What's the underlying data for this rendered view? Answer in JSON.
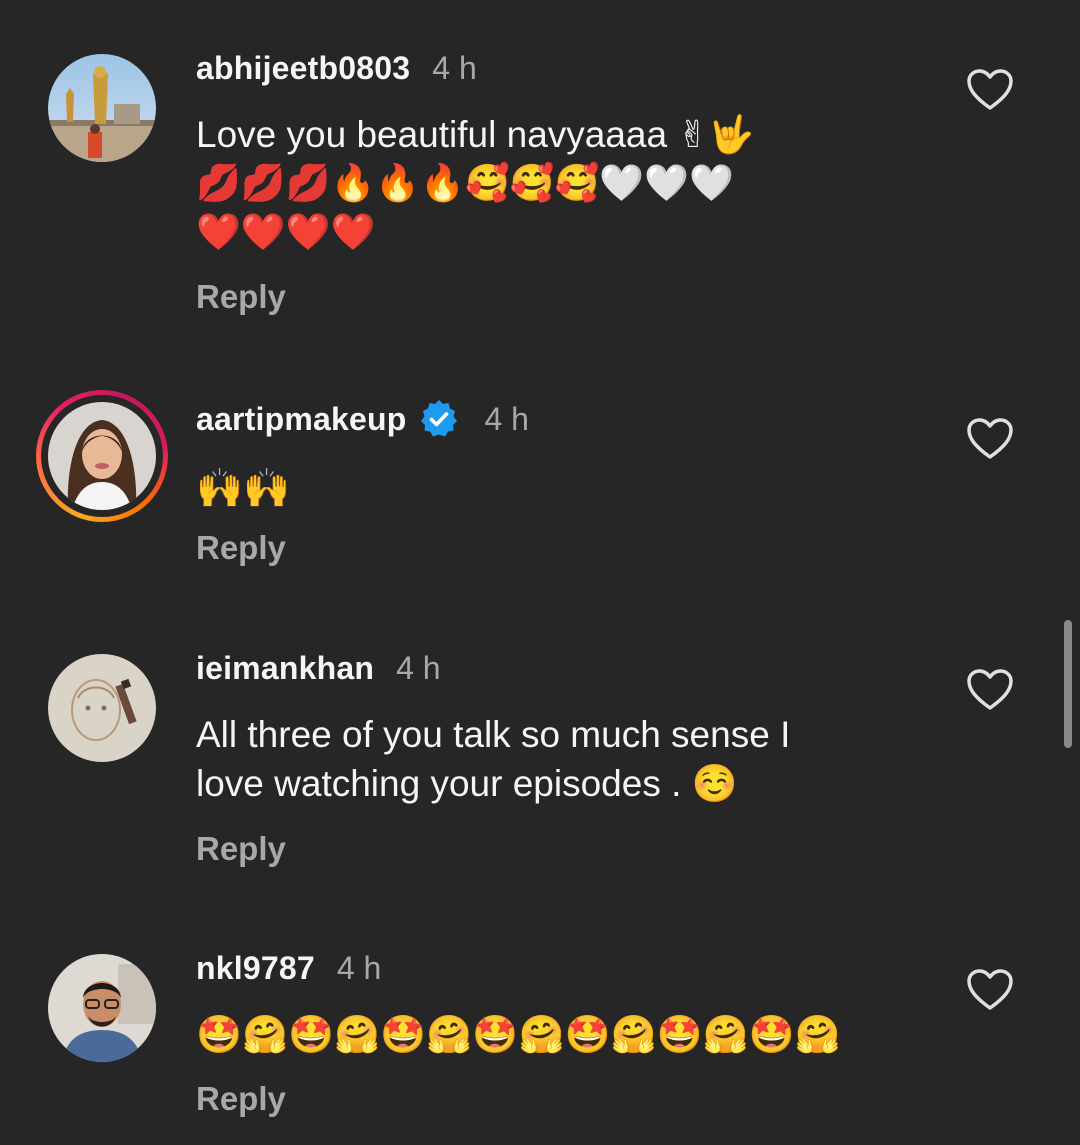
{
  "comments": [
    {
      "username": "abhijeetb0803",
      "time": "4 h",
      "text_line1": "Love you beautiful navyaaaa ✌🤟",
      "text_line2": "💋💋💋🔥🔥🔥🥰🥰🥰🤍🤍🤍",
      "text_line3": "❤️❤️❤️❤️",
      "reply": "Reply",
      "verified": false,
      "has_story": false
    },
    {
      "username": "aartipmakeup",
      "time": "4 h",
      "text_line1": "🙌🙌",
      "reply": "Reply",
      "verified": true,
      "has_story": true
    },
    {
      "username": "ieimankhan",
      "time": "4 h",
      "text_line1": "All three of you talk so much sense I",
      "text_line2": "love watching your episodes . ☺️",
      "reply": "Reply",
      "verified": false,
      "has_story": false
    },
    {
      "username": "nkl9787",
      "time": "4 h",
      "text_line1": "🤩🤗🤩🤗🤩🤗🤩🤗🤩🤗🤩🤗🤩🤗",
      "reply": "Reply",
      "verified": false,
      "has_story": false
    }
  ],
  "icons": {
    "like": "heart-outline-icon",
    "verified": "verified-badge-icon"
  },
  "colors": {
    "background": "#262626",
    "username": "#f5f5f5",
    "meta": "#a8a8a8",
    "verified_blue": "#0095f6"
  }
}
